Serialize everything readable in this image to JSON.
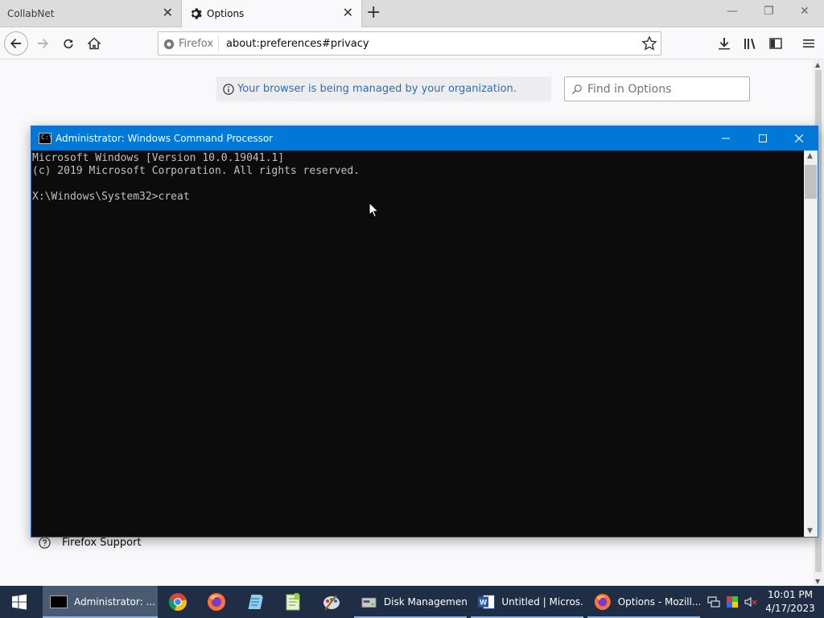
{
  "browser": {
    "tabs": [
      {
        "label": "CollabNet",
        "active": false
      },
      {
        "label": "Options",
        "active": true
      }
    ],
    "identity_label": "Firefox",
    "url": "about:preferences#privacy"
  },
  "preferences": {
    "policy_notice": "Your browser is being managed by your organization.",
    "find_placeholder": "Find in Options",
    "support_link": "Firefox Support"
  },
  "cmd": {
    "title": "Administrator: Windows Command Processor",
    "lines": [
      "Microsoft Windows [Version 10.0.19041.1]",
      "(c) 2019 Microsoft Corporation. All rights reserved.",
      "",
      "X:\\Windows\\System32>creat"
    ]
  },
  "taskbar": {
    "items": [
      {
        "label": "Administrator: ...",
        "icon": "cmd-icon"
      },
      {
        "label": "Disk Management",
        "icon": "disk-management-icon"
      },
      {
        "label": "Untitled | Micros...",
        "icon": "word-icon"
      },
      {
        "label": "Options - Mozill...",
        "icon": "firefox-icon"
      }
    ],
    "pinned": [
      "chrome-icon",
      "firefox-icon",
      "notepad-icon",
      "notepad-plus-icon",
      "paint-icon"
    ],
    "time": "10:01 PM",
    "date": "4/17/2023"
  },
  "colors": {
    "cmd_title_bg": "#0078d7",
    "taskbar_bg": "#1f2e44",
    "policy_text": "#2a6eb7"
  }
}
